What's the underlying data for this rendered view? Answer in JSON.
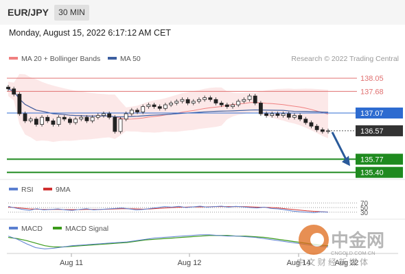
{
  "header": {
    "pair": "EUR/JPY",
    "interval": "30 MIN",
    "datetime": "Monday, August 15, 2022 6:17:12 AM CET"
  },
  "credit": "Research © 2022 Trading Central",
  "colors": {
    "bb": "#f08080",
    "ma50": "#3c5fa0",
    "resistance": "#e07070",
    "pivot": "#2d6bd0",
    "support": "#1f8a1f",
    "price_tag": "#333333",
    "arrow": "#2a5a9a",
    "rsi": "#5b7fd0",
    "rsi_ma": "#d03030",
    "macd": "#5b7fd0",
    "macd_signal": "#3a9a1a"
  },
  "chart_data": [
    {
      "type": "candlestick",
      "title": "EUR/JPY",
      "interval": "30 MIN",
      "legend": [
        "MA 20 + Bollinger Bands",
        "MA 50"
      ],
      "legend_position": "top-left",
      "x_labels": [
        "Aug 11",
        "Aug 12",
        "Aug 14",
        "Aug 22"
      ],
      "ylim": [
        135.2,
        138.4
      ],
      "close": [
        137.75,
        137.6,
        137.05,
        136.85,
        136.9,
        136.75,
        136.95,
        136.85,
        136.75,
        136.95,
        136.9,
        136.8,
        136.9,
        136.95,
        136.85,
        136.95,
        137.0,
        137.05,
        136.95,
        136.55,
        136.9,
        137.05,
        137.15,
        137.1,
        137.25,
        137.3,
        137.25,
        137.2,
        137.3,
        137.35,
        137.4,
        137.45,
        137.35,
        137.4,
        137.45,
        137.5,
        137.45,
        137.35,
        137.3,
        137.25,
        137.3,
        137.4,
        137.45,
        137.55,
        137.35,
        137.05,
        137.0,
        137.05,
        137.0,
        137.05,
        136.95,
        137.0,
        136.9,
        136.8,
        136.7,
        136.6,
        136.55,
        136.57
      ],
      "ma20_label": "MA 20",
      "ma50_label": "MA 50",
      "levels": [
        {
          "label": "138.05",
          "value": 138.05,
          "kind": "resistance"
        },
        {
          "label": "137.68",
          "value": 137.68,
          "kind": "resistance"
        },
        {
          "label": "137.07",
          "value": 137.07,
          "kind": "pivot"
        },
        {
          "label": "136.57",
          "value": 136.57,
          "kind": "price"
        },
        {
          "label": "135.77",
          "value": 135.77,
          "kind": "support"
        },
        {
          "label": "135.40",
          "value": 135.4,
          "kind": "support"
        }
      ],
      "forecast_arrow": {
        "from": 136.57,
        "to": 135.77
      }
    },
    {
      "type": "line",
      "legend": [
        "RSI",
        "9MA"
      ],
      "ylim": [
        0,
        100
      ],
      "levels": [
        "70",
        "50",
        "30"
      ],
      "rsi": [
        55,
        48,
        42,
        38,
        45,
        40,
        42,
        44,
        40,
        38,
        42,
        45,
        40,
        42,
        44,
        46,
        48,
        44,
        40,
        42,
        46,
        50,
        54,
        52,
        55,
        50,
        53,
        56,
        52,
        54,
        56,
        52,
        55,
        53,
        50,
        48,
        52,
        46,
        44,
        40,
        35,
        32,
        30,
        28,
        32,
        30
      ],
      "ma9": [
        52,
        50,
        47,
        44,
        43,
        42,
        42,
        42,
        41,
        41,
        41,
        42,
        42,
        42,
        43,
        44,
        45,
        45,
        44,
        43,
        44,
        46,
        48,
        50,
        51,
        52,
        53,
        53,
        53,
        54,
        54,
        54,
        54,
        54,
        53,
        52,
        51,
        50,
        48,
        45,
        42,
        39,
        36,
        34,
        32,
        31
      ]
    },
    {
      "type": "line",
      "legend": [
        "MACD",
        "MACD Signal"
      ],
      "macd": [
        0.1,
        0.05,
        -0.02,
        -0.08,
        -0.1,
        -0.09,
        -0.07,
        -0.05,
        -0.04,
        -0.03,
        -0.02,
        -0.01,
        0.0,
        0.01,
        0.03,
        0.05,
        0.07,
        0.08,
        0.09,
        0.1,
        0.11,
        0.12,
        0.12,
        0.11,
        0.1,
        0.1,
        0.09,
        0.08,
        0.06,
        0.04,
        0.02,
        0.0,
        -0.02,
        -0.04,
        -0.06,
        -0.07
      ],
      "signal": [
        0.08,
        0.06,
        0.03,
        -0.01,
        -0.05,
        -0.07,
        -0.07,
        -0.06,
        -0.05,
        -0.04,
        -0.03,
        -0.02,
        -0.01,
        0.0,
        0.02,
        0.04,
        0.05,
        0.06,
        0.07,
        0.08,
        0.09,
        0.1,
        0.11,
        0.11,
        0.11,
        0.1,
        0.1,
        0.09,
        0.08,
        0.06,
        0.04,
        0.02,
        0.0,
        -0.02,
        -0.04,
        -0.05
      ]
    }
  ],
  "watermark": {
    "name": "中金网",
    "domain": "CNGOLD.COM.CN",
    "tagline": "中 文 财 经 新 媒 体"
  }
}
